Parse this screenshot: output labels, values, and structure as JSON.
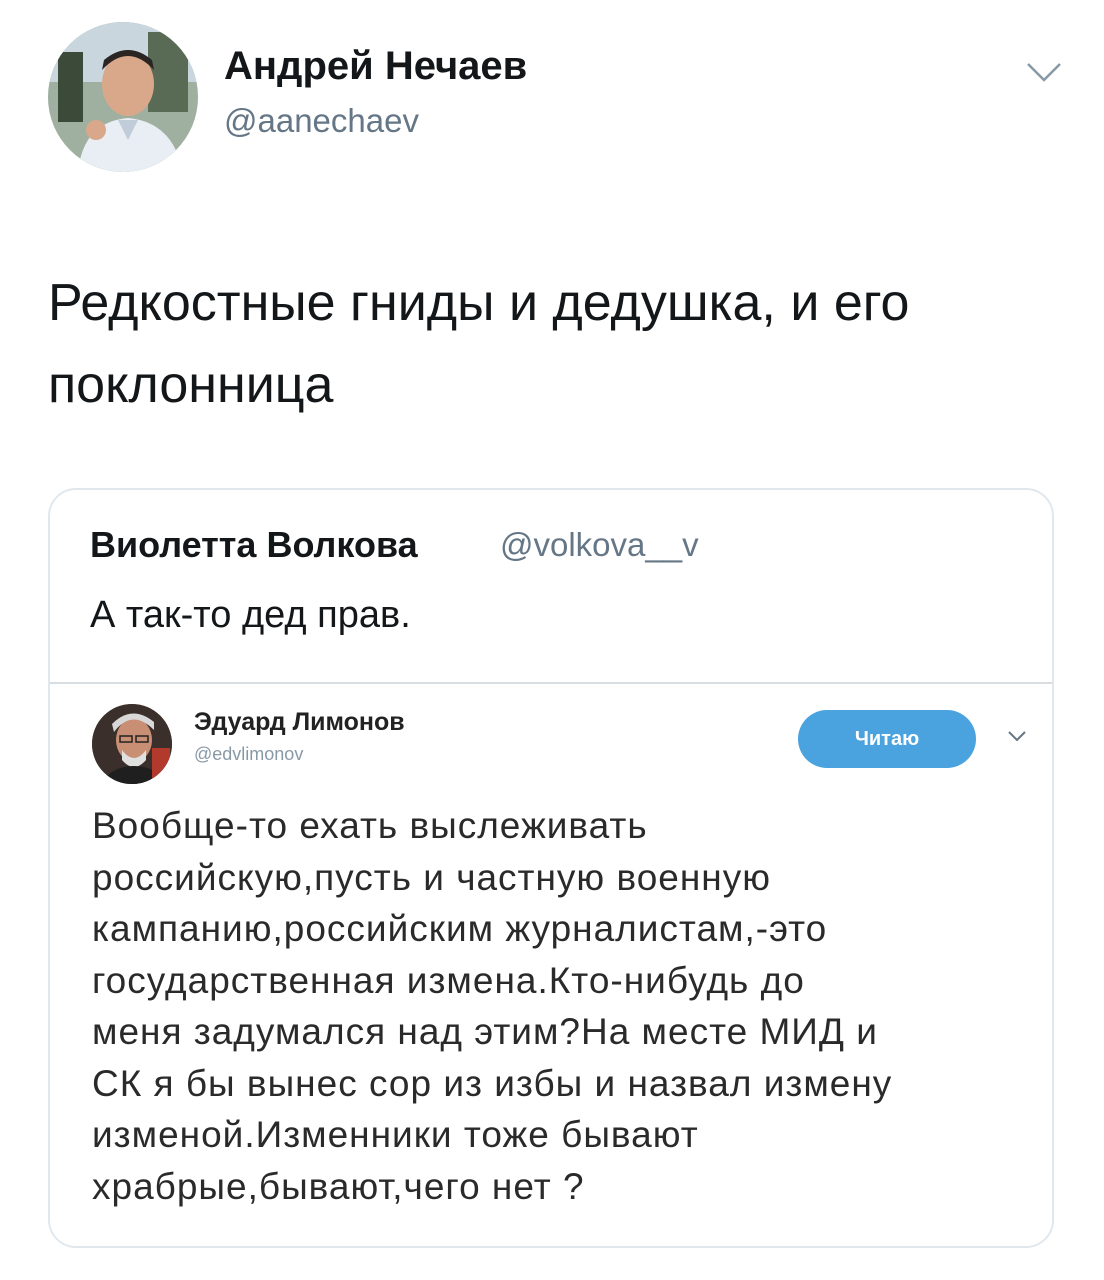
{
  "tweet": {
    "author_name": "Андрей Нечаев",
    "author_handle": "@aanechaev",
    "text_lines": [
      "Редкостные гниды и дедушка, и его",
      "поклонница"
    ],
    "menu_icon": "chevron-down-icon"
  },
  "quote": {
    "author_name": "Виолетта Волкова",
    "author_handle": "@volkova__v",
    "text": "А так-то дед прав.",
    "embedded": {
      "author_name": "Эдуард Лимонов",
      "author_handle": "@edvlimonov",
      "follow_label": "Читаю",
      "menu_icon": "chevron-down-icon",
      "text_lines": [
        "Вообще-то ехать выслеживать",
        "российскую,пусть и частную военную",
        "кампанию,российским журналистам,-это",
        "государственная измена.Кто-нибудь до",
        "меня задумался над этим?На месте МИД и",
        "СК я бы вынес сор из избы и назвал измену",
        "изменой.Изменники тоже бывают",
        "храбрые,бывают,чего нет ?"
      ]
    }
  },
  "colors": {
    "accent": "#4aa3df",
    "muted": "#657786",
    "border": "#e1e8ed"
  }
}
